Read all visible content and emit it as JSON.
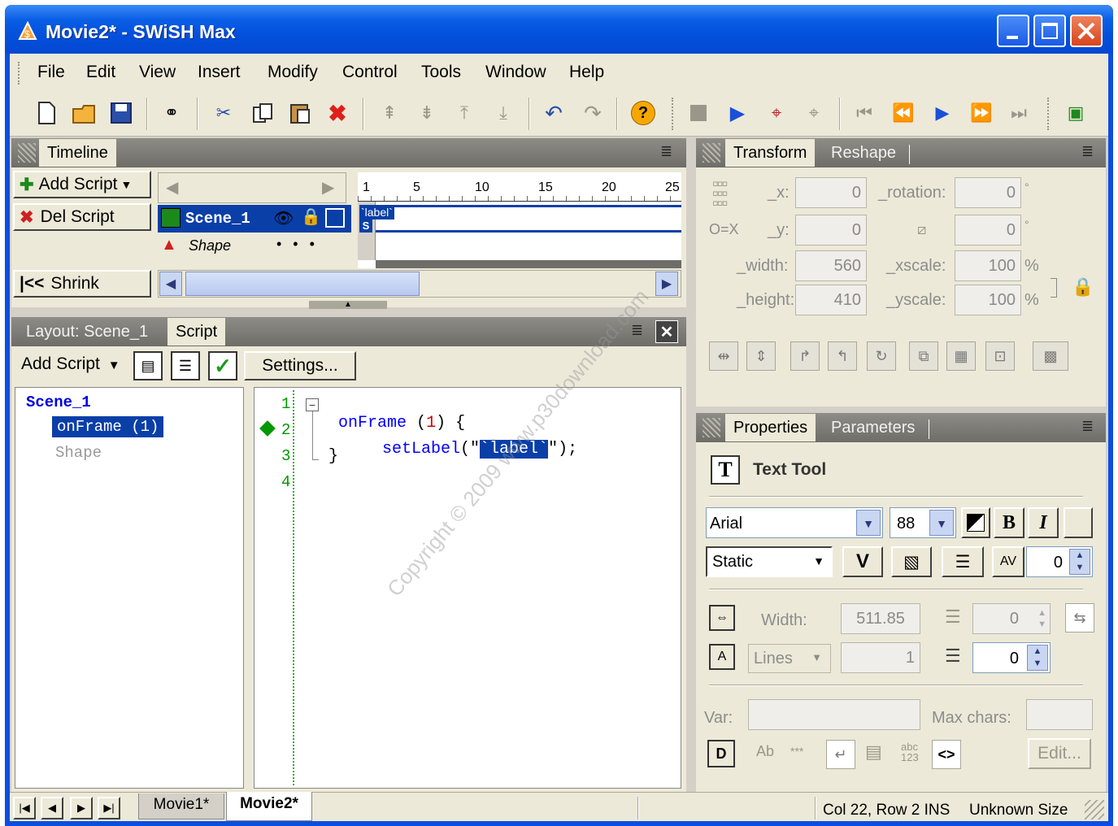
{
  "window": {
    "title": "Movie2* - SWiSH Max"
  },
  "menu": [
    "File",
    "Edit",
    "View",
    "Insert",
    "Modify",
    "Control",
    "Tools",
    "Window",
    "Help"
  ],
  "timeline": {
    "tab": "Timeline",
    "add_script": "Add Script",
    "del_script": "Del Script",
    "shrink": "Shrink",
    "scene_name": "Scene_1",
    "shape_name": "Shape",
    "ruler": [
      "1",
      "5",
      "10",
      "15",
      "20",
      "25"
    ],
    "frame_label": "`label`",
    "frame_marker": "S"
  },
  "layout_panel": {
    "tab_layout": "Layout: Scene_1",
    "tab_script": "Script",
    "add_script": "Add Script",
    "settings": "Settings...",
    "tree": {
      "scene": "Scene_1",
      "onframe": "onFrame (1)",
      "shape": "Shape"
    },
    "code": {
      "line_numbers": [
        "1",
        "2",
        "3",
        "4"
      ],
      "line1_kw": "onFrame",
      "line1_open": "(",
      "line1_num": "1",
      "line1_close": ") {",
      "line2_fn": "setLabel",
      "line2_open": "(\"",
      "line2_sel": "`label`",
      "line2_close": "\");",
      "line3": "}"
    }
  },
  "transform": {
    "tab_transform": "Transform",
    "tab_reshape": "Reshape",
    "x_label": "_x:",
    "x": "0",
    "y_label": "_y:",
    "y": "0",
    "ox_label": "O=X",
    "rotation_label": "_rotation:",
    "rotation": "0",
    "skew": "0",
    "width_label": "_width:",
    "width": "560",
    "height_label": "_height:",
    "height": "410",
    "xscale_label": "_xscale:",
    "xscale": "100",
    "yscale_label": "_yscale:",
    "yscale": "100",
    "pct": "%",
    "deg": "°"
  },
  "properties": {
    "tab_properties": "Properties",
    "tab_parameters": "Parameters",
    "tool": "Text Tool",
    "font": "Arial",
    "size": "88",
    "type": "Static",
    "kerning": "0",
    "width_label": "Width:",
    "width": "511.85",
    "indent": "0",
    "lines_label": "Lines",
    "lines": "1",
    "line_spacing": "0",
    "var_label": "Var:",
    "maxchars_label": "Max chars:",
    "edit": "Edit..."
  },
  "status": {
    "tab_movie1": "Movie1*",
    "tab_movie2": "Movie2*",
    "position": "Col 22, Row 2 INS",
    "size": "Unknown Size"
  },
  "watermark": "Copyright © 2009 www.p30download.com",
  "colors": {
    "accent": "#0a5fe6",
    "selection": "#0a3fa8",
    "keyword": "#0000ff",
    "green": "#009900"
  }
}
